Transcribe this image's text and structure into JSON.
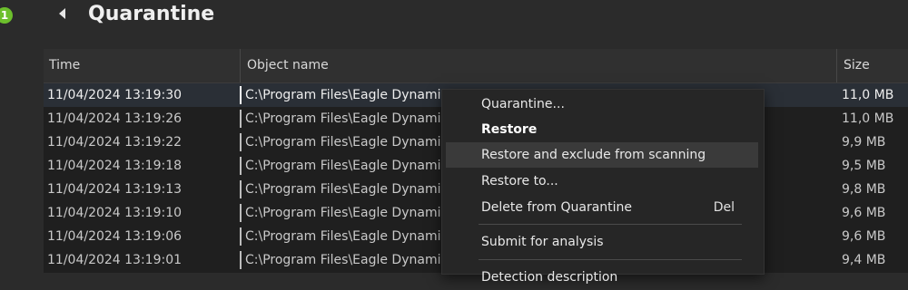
{
  "badge": "1",
  "page": {
    "title": "Quarantine"
  },
  "table": {
    "columns": {
      "time": "Time",
      "object": "Object name",
      "size": "Size"
    },
    "rows": [
      {
        "time": "11/04/2024 13:19:30",
        "object": "C:\\Program Files\\Eagle Dynami",
        "size": "11,0 MB"
      },
      {
        "time": "11/04/2024 13:19:26",
        "object": "C:\\Program Files\\Eagle Dynami",
        "size": "11,0 MB"
      },
      {
        "time": "11/04/2024 13:19:22",
        "object": "C:\\Program Files\\Eagle Dynami",
        "size": "9,9 MB"
      },
      {
        "time": "11/04/2024 13:19:18",
        "object": "C:\\Program Files\\Eagle Dynami",
        "size": "9,5 MB"
      },
      {
        "time": "11/04/2024 13:19:13",
        "object": "C:\\Program Files\\Eagle Dynami",
        "size": "9,8 MB"
      },
      {
        "time": "11/04/2024 13:19:10",
        "object": "C:\\Program Files\\Eagle Dynami",
        "size": "9,6 MB"
      },
      {
        "time": "11/04/2024 13:19:06",
        "object": "C:\\Program Files\\Eagle Dynami",
        "size": "9,6 MB"
      },
      {
        "time": "11/04/2024 13:19:01",
        "object": "C:\\Program Files\\Eagle Dynami",
        "size": "9,4 MB"
      }
    ]
  },
  "context_menu": {
    "quarantine": "Quarantine...",
    "restore": "Restore",
    "restore_exclude": "Restore and exclude from scanning",
    "restore_to": "Restore to...",
    "delete": "Delete from Quarantine",
    "delete_shortcut": "Del",
    "submit": "Submit for analysis",
    "detection": "Detection description"
  },
  "colors": {
    "badge": "#6cbf2c",
    "background": "#2b2b2b",
    "menu": "#262626"
  },
  "icons": {
    "back": "back-arrow-icon"
  }
}
